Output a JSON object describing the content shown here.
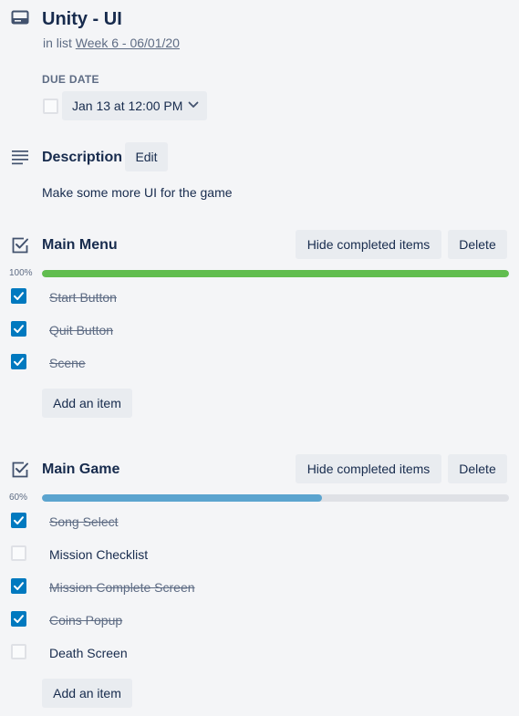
{
  "card": {
    "title": "Unity - UI",
    "in_list_prefix": "in list",
    "list_name": "Week 6 - 06/01/20"
  },
  "due_date": {
    "label": "DUE DATE",
    "value": "Jan 13 at 12:00 PM",
    "completed": false
  },
  "description": {
    "title": "Description",
    "edit_label": "Edit",
    "text": "Make some more UI for the game"
  },
  "checklists": [
    {
      "title": "Main Menu",
      "hide_label": "Hide completed items",
      "delete_label": "Delete",
      "progress_text": "100%",
      "progress": 1.0,
      "progress_color": "#61bd4f",
      "add_label": "Add an item",
      "items": [
        {
          "label": "Start Button",
          "checked": true
        },
        {
          "label": "Quit Button",
          "checked": true
        },
        {
          "label": "Scene",
          "checked": true
        }
      ]
    },
    {
      "title": "Main Game",
      "hide_label": "Hide completed items",
      "delete_label": "Delete",
      "progress_text": "60%",
      "progress": 0.6,
      "progress_color": "#5ba4cf",
      "add_label": "Add an item",
      "items": [
        {
          "label": "Song Select",
          "checked": true
        },
        {
          "label": "Mission Checklist",
          "checked": false
        },
        {
          "label": "Mission Complete Screen",
          "checked": true
        },
        {
          "label": "Coins Popup",
          "checked": true
        },
        {
          "label": "Death Screen",
          "checked": false
        }
      ]
    }
  ],
  "icons": {
    "card": "card-icon",
    "description": "description-icon",
    "checklist": "checklist-icon",
    "chevron": "chevron-down-icon",
    "check": "check-icon"
  },
  "colors": {
    "checkbox_checked": "#0079bf",
    "button_bg": "#e9ecf0",
    "muted_text": "#5e6c84"
  }
}
